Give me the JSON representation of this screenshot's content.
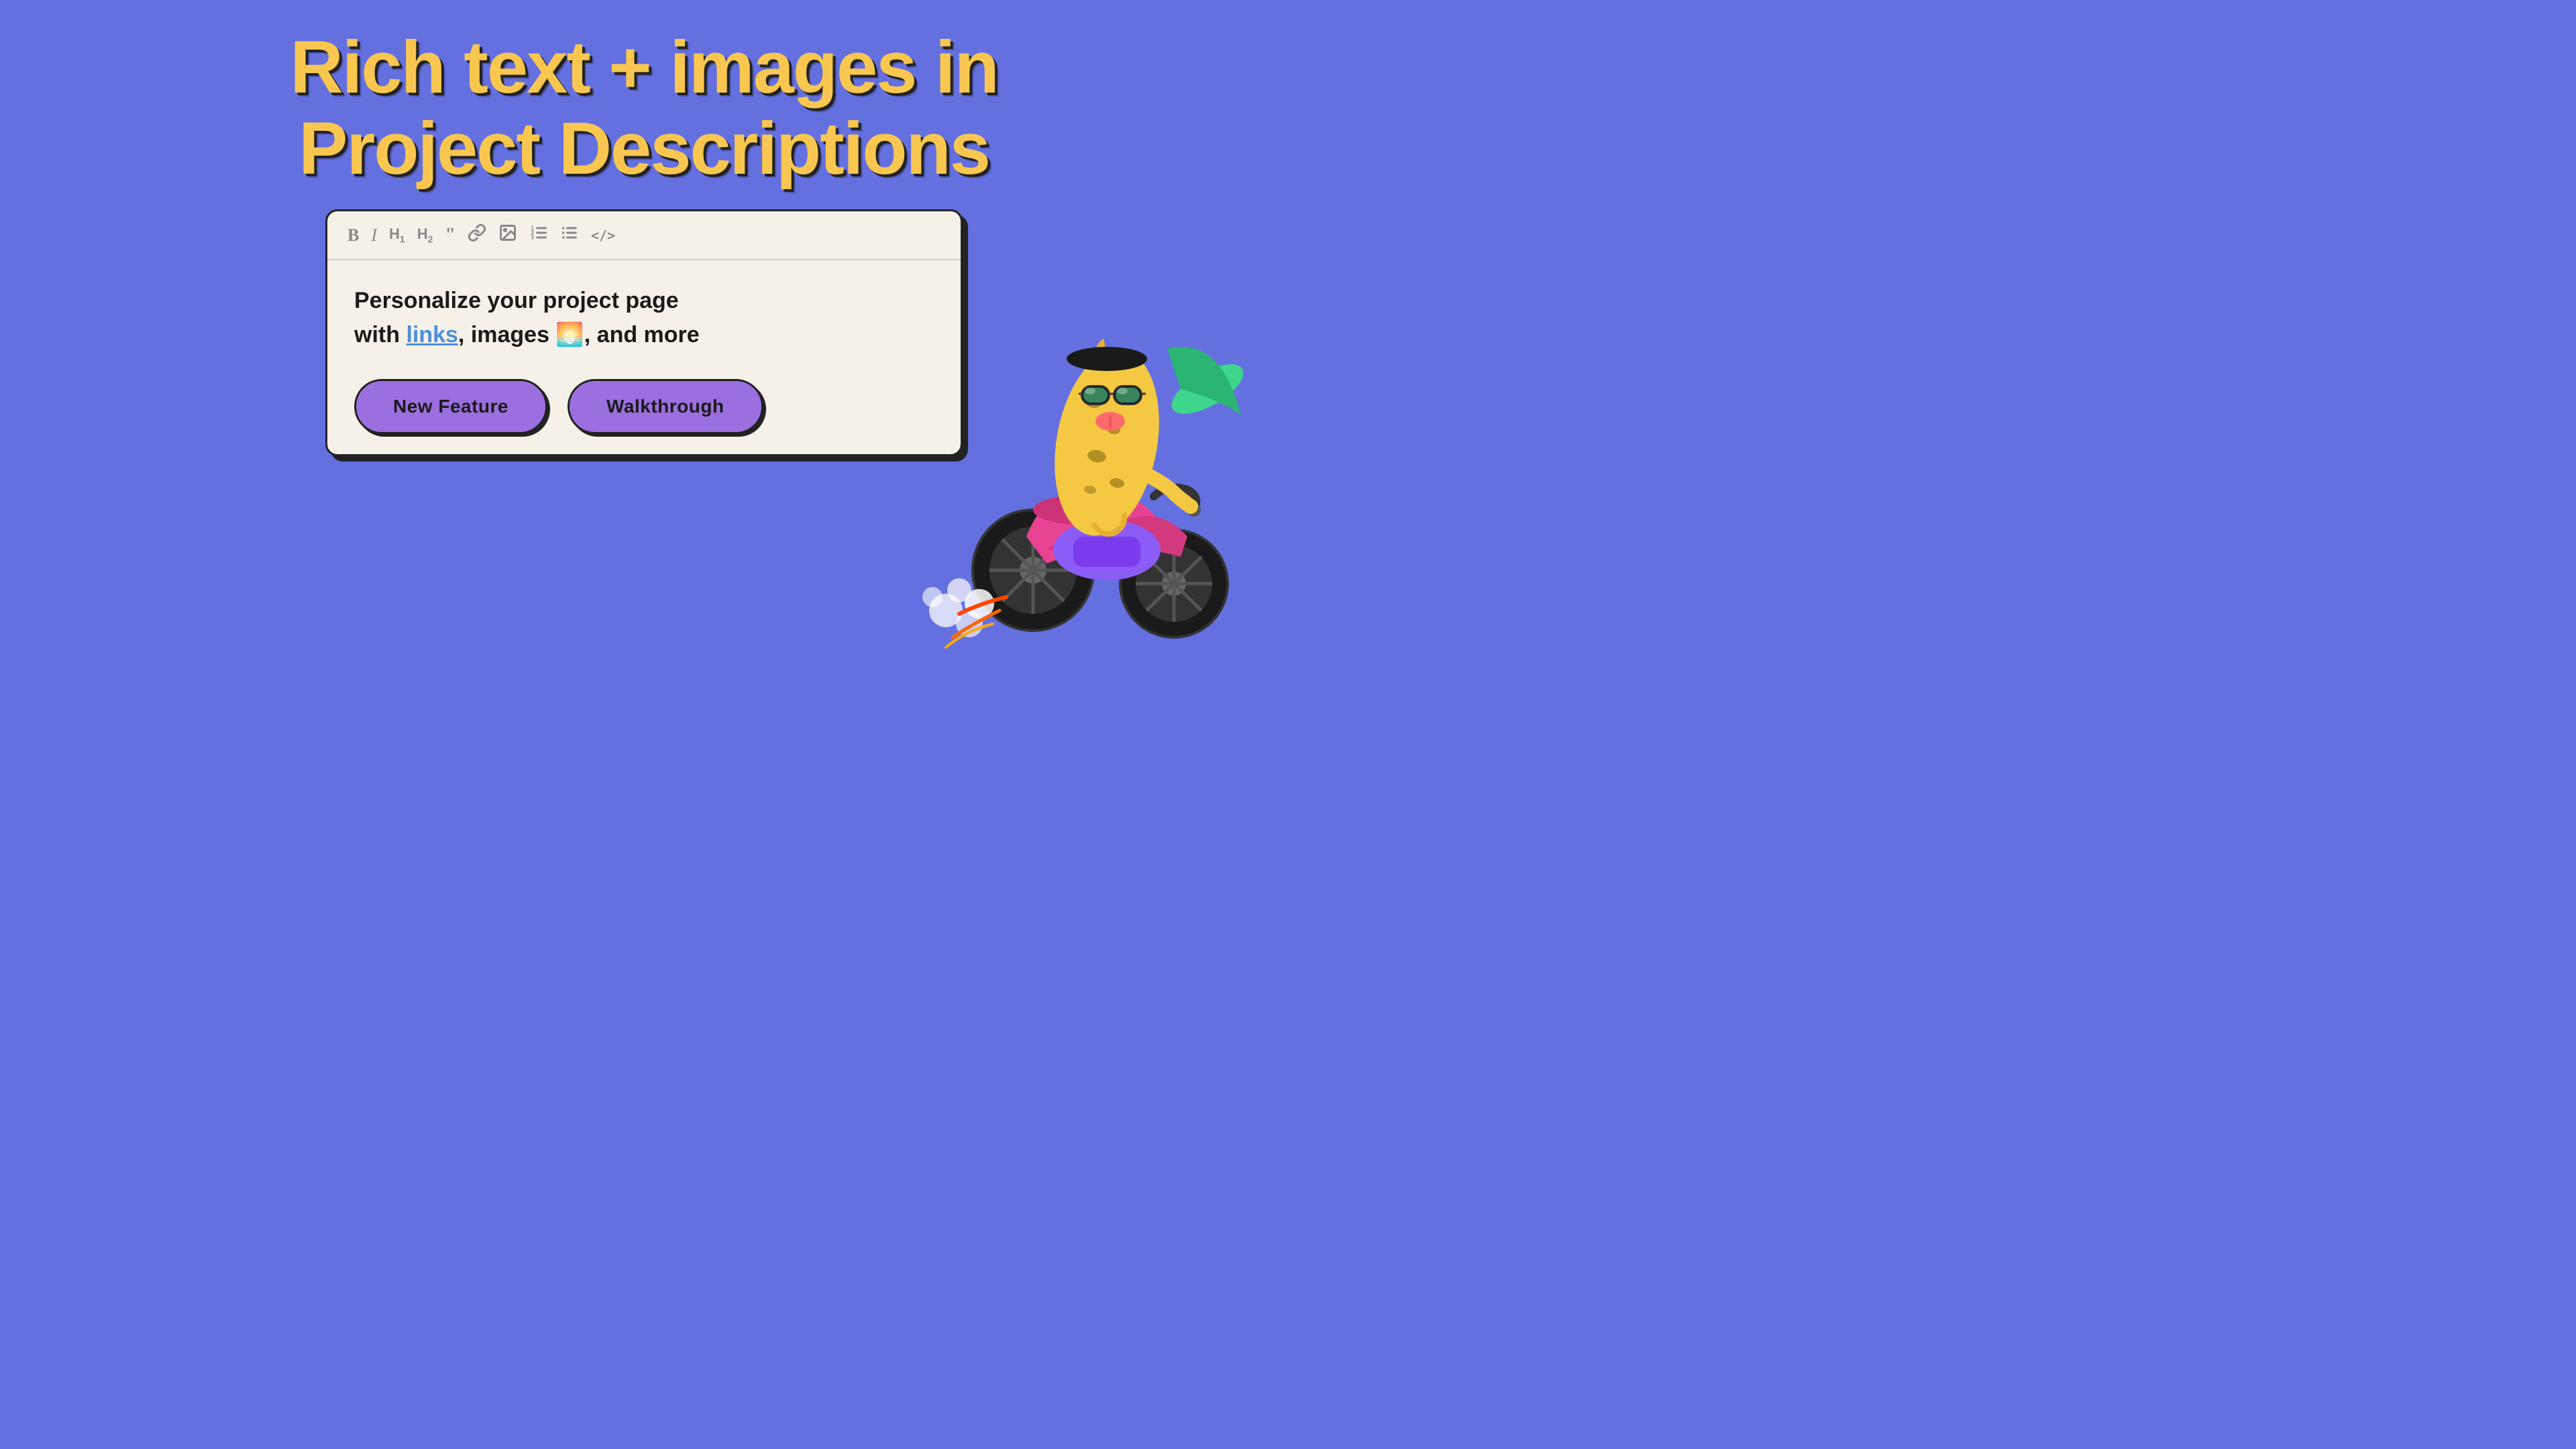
{
  "page": {
    "background_color": "#6470e0"
  },
  "title": {
    "line1": "Rich text + images in",
    "line2": "Project Descriptions"
  },
  "toolbar": {
    "icons": [
      {
        "name": "bold",
        "symbol": "B",
        "label": "Bold"
      },
      {
        "name": "italic",
        "symbol": "I",
        "label": "Italic"
      },
      {
        "name": "h1",
        "symbol": "H₁",
        "label": "Heading 1"
      },
      {
        "name": "h2",
        "symbol": "H₂",
        "label": "Heading 2"
      },
      {
        "name": "quote",
        "symbol": "❝",
        "label": "Quote"
      },
      {
        "name": "link",
        "symbol": "⛓",
        "label": "Link"
      },
      {
        "name": "image",
        "symbol": "⊟",
        "label": "Image"
      },
      {
        "name": "ordered-list",
        "symbol": "≡",
        "label": "Ordered List"
      },
      {
        "name": "unordered-list",
        "symbol": "☰",
        "label": "Unordered List"
      },
      {
        "name": "code",
        "symbol": "</>",
        "label": "Code"
      }
    ]
  },
  "editor": {
    "content_line1": "Personalize your project page",
    "content_line2_prefix": "with ",
    "content_link": "links",
    "content_line2_suffix": ", images 🌅, and more"
  },
  "buttons": [
    {
      "label": "New Feature",
      "name": "new-feature-button"
    },
    {
      "label": "Walkthrough",
      "name": "walkthrough-button"
    }
  ],
  "accent_color": "#f9c74f",
  "button_color": "#9b6fe0"
}
